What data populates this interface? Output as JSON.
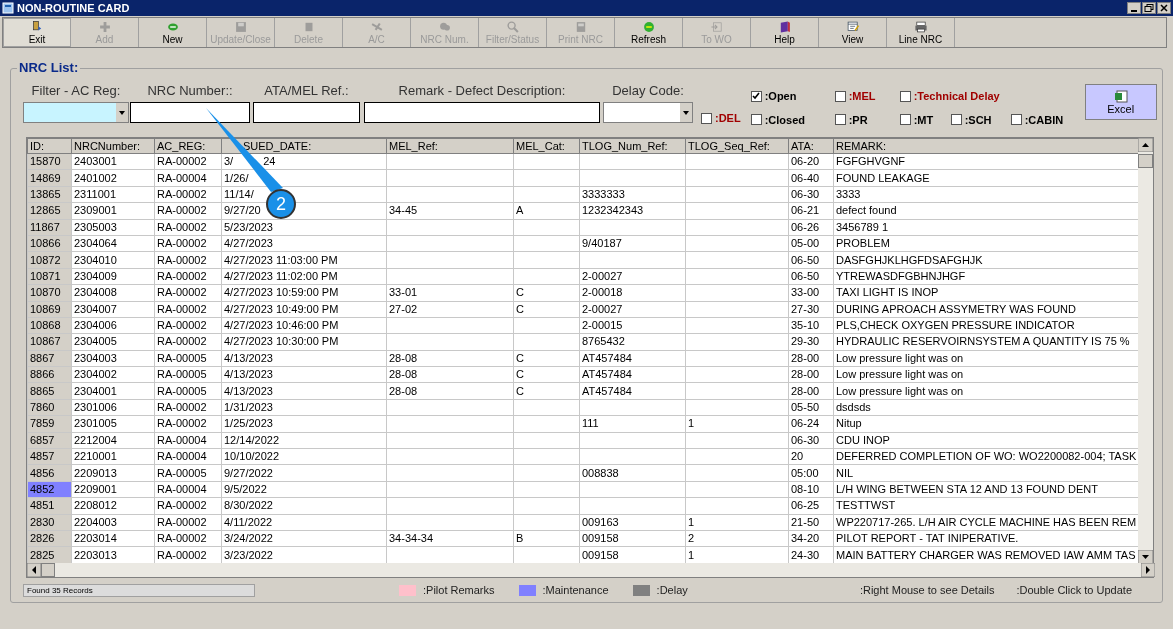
{
  "window": {
    "title": "NON-ROUTINE CARD"
  },
  "toolbar": [
    {
      "label": "Exit",
      "disabled": false
    },
    {
      "label": "Add",
      "disabled": true
    },
    {
      "label": "New",
      "disabled": false
    },
    {
      "label": "Update/Close",
      "disabled": true
    },
    {
      "label": "Delete",
      "disabled": true
    },
    {
      "label": "A/C",
      "disabled": true
    },
    {
      "label": "NRC Num.",
      "disabled": true
    },
    {
      "label": "Filter/Status",
      "disabled": true
    },
    {
      "label": "Print NRC",
      "disabled": true
    },
    {
      "label": "Refresh",
      "disabled": false
    },
    {
      "label": "To WO",
      "disabled": true
    },
    {
      "label": "Help",
      "disabled": false
    },
    {
      "label": "View",
      "disabled": false
    },
    {
      "label": "Line NRC",
      "disabled": false
    }
  ],
  "panel": {
    "title": "NRC List:",
    "filters": {
      "ac_reg_label": "Filter - AC Reg:",
      "nrc_number_label": "NRC Number::",
      "ata_mel_label": "ATA/MEL Ref.:",
      "remark_label": "Remark - Defect Description:",
      "delay_code_label": "Delay Code:"
    },
    "del_filter": {
      "label": ":DEL",
      "checked": false,
      "color": "#a00000"
    },
    "status_filters": {
      "row_1": [
        {
          "label": ":Open",
          "checked": true,
          "color": "#000000"
        },
        {
          "label": ":MEL",
          "checked": false,
          "color": "#a00000"
        },
        {
          "label": ":Technical Delay",
          "checked": false,
          "color": "#a00000"
        }
      ],
      "row_2": [
        {
          "label": ":Closed",
          "checked": false,
          "color": "#000000"
        },
        {
          "label": ":PR",
          "checked": false,
          "color": "#000000"
        },
        {
          "label": ":MT",
          "checked": false,
          "color": "#000000"
        },
        {
          "label": ":SCH",
          "checked": false,
          "color": "#000000"
        },
        {
          "label": ":CABIN",
          "checked": false,
          "color": "#000000"
        }
      ]
    },
    "excel_button": "Excel",
    "table": {
      "columns": [
        "ID:",
        "NRCNumber:",
        "AC_REG:",
        "SUED_DATE:",
        "MEL_Ref:",
        "MEL_Cat:",
        "TLOG_Num_Ref:",
        "TLOG_Seq_Ref:",
        "ATA:",
        "REMARK:"
      ],
      "rows": [
        {
          "selected": false,
          "cells": [
            "15870",
            "2403001",
            "RA-00002",
            [
              "3/",
              "24"
            ],
            "",
            "",
            "",
            "",
            "06-20",
            "FGFGHVGNF"
          ]
        },
        {
          "selected": false,
          "cells": [
            "14869",
            "2401002",
            "RA-00004",
            "1/26/",
            "",
            "",
            "",
            "",
            "06-40",
            "FOUND LEAKAGE"
          ]
        },
        {
          "selected": false,
          "cells": [
            "13865",
            "2311001",
            "RA-00002",
            "11/14/",
            "",
            "",
            "3333333",
            "",
            "06-30",
            "3333"
          ]
        },
        {
          "selected": false,
          "cells": [
            "12865",
            "2309001",
            "RA-00002",
            "9/27/20",
            "34-45",
            "A",
            "1232342343",
            "",
            "06-21",
            "defect found"
          ]
        },
        {
          "selected": false,
          "cells": [
            "11867",
            "2305003",
            "RA-00002",
            "5/23/2023",
            "",
            "",
            "",
            "",
            "06-26",
            "3456789 1"
          ]
        },
        {
          "selected": false,
          "cells": [
            "10866",
            "2304064",
            "RA-00002",
            "4/27/2023",
            "",
            "",
            "9/40187",
            "",
            "05-00",
            "PROBLEM"
          ]
        },
        {
          "selected": false,
          "cells": [
            "10872",
            "2304010",
            "RA-00002",
            "4/27/2023 11:03:00 PM",
            "",
            "",
            "",
            "",
            "06-50",
            "DASFGHJKLHGFDSAFGHJK"
          ]
        },
        {
          "selected": false,
          "cells": [
            "10871",
            "2304009",
            "RA-00002",
            "4/27/2023 11:02:00 PM",
            "",
            "",
            "2-00027",
            "",
            "06-50",
            "YTREWASDFGBHNJHGF"
          ]
        },
        {
          "selected": false,
          "cells": [
            "10870",
            "2304008",
            "RA-00002",
            "4/27/2023 10:59:00 PM",
            "33-01",
            "C",
            "2-00018",
            "",
            "33-00",
            "TAXI LIGHT IS INOP"
          ]
        },
        {
          "selected": false,
          "cells": [
            "10869",
            "2304007",
            "RA-00002",
            "4/27/2023 10:49:00 PM",
            "27-02",
            "C",
            "2-00027",
            "",
            "27-30",
            "DURING APROACH ASSYMETRY WAS FOUND"
          ]
        },
        {
          "selected": false,
          "cells": [
            "10868",
            "2304006",
            "RA-00002",
            "4/27/2023 10:46:00 PM",
            "",
            "",
            "2-00015",
            "",
            "35-10",
            "PLS,CHECK OXYGEN PRESSURE INDICATOR"
          ]
        },
        {
          "selected": false,
          "cells": [
            "10867",
            "2304005",
            "RA-00002",
            "4/27/2023 10:30:00 PM",
            "",
            "",
            "8765432",
            "",
            "29-30",
            "HYDRAULIC RESERVOIRNSYSTEM A QUANTITY IS 75 %"
          ]
        },
        {
          "selected": false,
          "cells": [
            "8867",
            "2304003",
            "RA-00005",
            "4/13/2023",
            "28-08",
            "C",
            "AT457484",
            "",
            "28-00",
            "Low pressure light was on"
          ]
        },
        {
          "selected": false,
          "cells": [
            "8866",
            "2304002",
            "RA-00005",
            "4/13/2023",
            "28-08",
            "C",
            "AT457484",
            "",
            "28-00",
            "Low pressure light was on"
          ]
        },
        {
          "selected": false,
          "cells": [
            "8865",
            "2304001",
            "RA-00005",
            "4/13/2023",
            "28-08",
            "C",
            "AT457484",
            "",
            "28-00",
            "Low pressure light was on"
          ]
        },
        {
          "selected": false,
          "cells": [
            "7860",
            "2301006",
            "RA-00002",
            "1/31/2023",
            "",
            "",
            "",
            "",
            "05-50",
            "dsdsds"
          ]
        },
        {
          "selected": false,
          "cells": [
            "7859",
            "2301005",
            "RA-00002",
            "1/25/2023",
            "",
            "",
            "111",
            "1",
            "06-24",
            "Nitup"
          ]
        },
        {
          "selected": false,
          "cells": [
            "6857",
            "2212004",
            "RA-00004",
            "12/14/2022",
            "",
            "",
            "",
            "",
            "06-30",
            "CDU INOP"
          ]
        },
        {
          "selected": false,
          "cells": [
            "4857",
            "2210001",
            "RA-00004",
            "10/10/2022",
            "",
            "",
            "",
            "",
            "20",
            "DEFERRED COMPLETION OF WO: WO2200082-004; TASK"
          ]
        },
        {
          "selected": false,
          "cells": [
            "4856",
            "2209013",
            "RA-00005",
            "9/27/2022",
            "",
            "",
            "008838",
            "",
            "05:00",
            "NIL"
          ]
        },
        {
          "selected": true,
          "cells": [
            "4852",
            "2209001",
            "RA-00004",
            "9/5/2022",
            "",
            "",
            "",
            "",
            "08-10",
            "L/H WING BETWEEN STA 12 AND 13 FOUND DENT"
          ]
        },
        {
          "selected": false,
          "cells": [
            "4851",
            "2208012",
            "RA-00002",
            "8/30/2022",
            "",
            "",
            "",
            "",
            "06-25",
            "TESTTWST"
          ]
        },
        {
          "selected": false,
          "cells": [
            "2830",
            "2204003",
            "RA-00002",
            "4/11/2022",
            "",
            "",
            "009163",
            "1",
            "21-50",
            "WP220717-265. L/H AIR CYCLE MACHINE HAS BEEN REM"
          ]
        },
        {
          "selected": false,
          "cells": [
            "2826",
            "2203014",
            "RA-00002",
            "3/24/2022",
            "34-34-34",
            "B",
            "009158",
            "2",
            "34-20",
            "PILOT REPORT - TAT INIPERATIVE."
          ]
        },
        {
          "selected": false,
          "cells": [
            "2825",
            "2203013",
            "RA-00002",
            "3/23/2022",
            "",
            "",
            "009158",
            "1",
            "24-30",
            "MAIN BATTERY CHARGER WAS REMOVED IAW AMM TAS"
          ]
        }
      ]
    },
    "record_count": "Found 35 Records",
    "legend": [
      {
        "label": ":Pilot Remarks",
        "color": "#ffc0cb"
      },
      {
        "label": ":Maintenance",
        "color": "#8080ff"
      },
      {
        "label": ":Delay",
        "color": "#808080"
      }
    ],
    "hints": [
      ":Right Mouse to see Details",
      ":Double Click to Update"
    ]
  },
  "callout": {
    "label": "2"
  }
}
